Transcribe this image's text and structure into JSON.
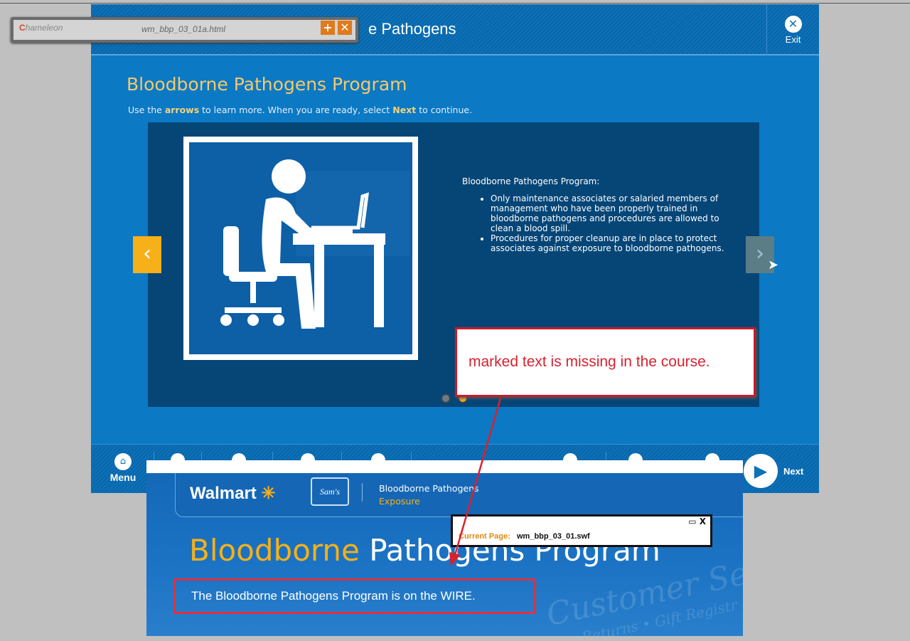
{
  "course": {
    "title": "e Pathogens",
    "exit_label": "Exit",
    "page_heading": "Bloodborne Pathogens Program",
    "instruction": {
      "part1": "Use the ",
      "arrows": "arrows",
      "part2": " to learn more.  When you are ready, select ",
      "next": "Next",
      "part3": " to continue."
    },
    "slide": {
      "heading": "Bloodborne Pathogens Program:",
      "bullets": [
        "Only maintenance associates or salaried members of management who have been properly trained in bloodborne pathogens and procedures are allowed to clean a blood spill.",
        "Procedures for proper cleanup are in place to protect associates against exposure to bloodborne pathogens."
      ],
      "current_dot": 2,
      "total_dots": 2
    },
    "bottom_bar": {
      "menu_label": "Menu",
      "next_label": "Next"
    }
  },
  "chameleon_toolbar": {
    "logo": "hameleon",
    "file": "wm_bbp_03_01a.html"
  },
  "inset": {
    "walmart": "Walmart",
    "sams": "Sam's",
    "subtitle1": "Bloodborne Pathogens",
    "subtitle2": "Exposure",
    "title_gold": "Bloodborne",
    "title_white": " Pathogens Program",
    "callout": "The Bloodborne Pathogens Program is on the WIRE.",
    "watermark1": "Customer Serv",
    "watermark2": "Returns • Gift Registr",
    "current_page_label": "Current Page:",
    "current_page_value": "wm_bbp_03_01.swf"
  },
  "annotation": {
    "text": "marked text is missing in the course."
  },
  "colors": {
    "course_blue": "#0b79c4",
    "accent_gold": "#f5b01a",
    "annotation_red": "#d8212f"
  }
}
